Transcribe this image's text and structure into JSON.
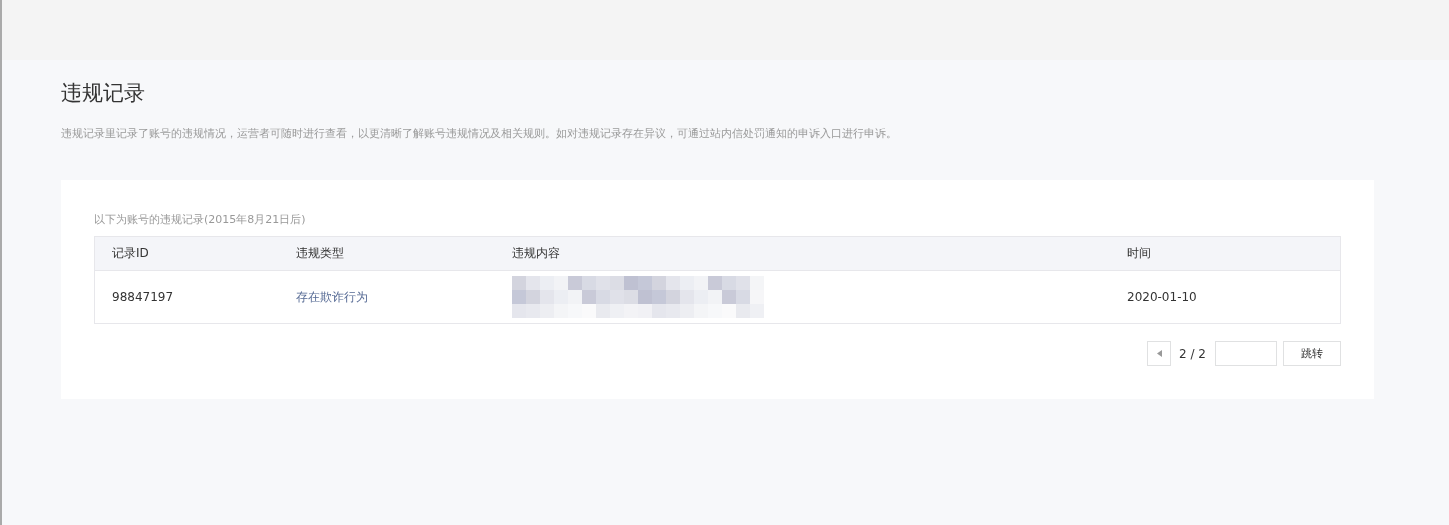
{
  "page": {
    "title": "违规记录",
    "description": "违规记录里记录了账号的违规情况，运营者可随时进行查看，以更清晰了解账号违规情况及相关规则。如对违规记录存在异议，可通过站内信处罚通知的申诉入口进行申诉。"
  },
  "table": {
    "caption": "以下为账号的违规记录(2015年8月21日后)",
    "columns": [
      "记录ID",
      "违规类型",
      "违规内容",
      "时间"
    ],
    "rows": [
      {
        "id": "98847197",
        "type": "存在欺诈行为",
        "time": "2020-01-10"
      }
    ]
  },
  "pagination": {
    "page": "2 / 2",
    "jump_button": "跳转"
  }
}
